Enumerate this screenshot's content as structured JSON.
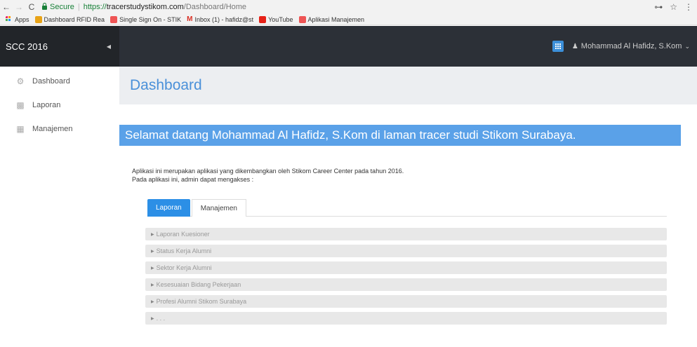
{
  "browser": {
    "back": "←",
    "forward": "→",
    "reload": "C",
    "secure_label": "Secure",
    "url_scheme": "https://",
    "url_host": "tracerstudystikom.com",
    "url_path": "/Dashboard/Home",
    "key_icon": "key-icon",
    "star_icon": "star-icon",
    "menu_icon": "⋮",
    "bookmarks": [
      {
        "label": "Apps",
        "icon": "apps-icon"
      },
      {
        "label": "Dashboard RFID Rea",
        "icon": "rfid-icon"
      },
      {
        "label": "Single Sign On - STIK",
        "icon": "sso-icon"
      },
      {
        "label": "Inbox (1) - hafidz@st",
        "icon": "gmail-icon"
      },
      {
        "label": "YouTube",
        "icon": "youtube-icon"
      },
      {
        "label": "Aplikasi Manajemen",
        "icon": "sso-icon"
      }
    ]
  },
  "topbar": {
    "brand": "SCC 2016",
    "user_name": "Mohammad Al Hafidz, S.Kom"
  },
  "sidebar": {
    "items": [
      {
        "label": "Dashboard",
        "icon": "dashboard-icon"
      },
      {
        "label": "Laporan",
        "icon": "bar-chart-icon"
      },
      {
        "label": "Manajemen",
        "icon": "table-icon"
      }
    ]
  },
  "main": {
    "title": "Dashboard",
    "welcome": "Selamat datang Mohammad Al Hafidz, S.Kom di laman tracer studi Stikom Surabaya.",
    "desc_line1": "Aplikasi ini merupakan aplikasi yang dikembangkan oleh Stikom Career Center pada tahun 2016.",
    "desc_line2": "Pada aplikasi ini, admin dapat mengakses :",
    "tabs": [
      {
        "label": "Laporan",
        "active": true
      },
      {
        "label": "Manajemen",
        "active": false
      }
    ],
    "accordion": [
      "Laporan Kuesioner",
      "Status Kerja Alumni",
      "Sektor Kerja Alumni",
      "Kesesuaian Bidang Pekerjaan",
      "Profesi Alumni Stikom Surabaya",
      ". . ."
    ]
  },
  "colors": {
    "accent": "#2c8fe6",
    "welcome_bg": "#5aa1e8",
    "topbar_bg": "#2c3037"
  }
}
